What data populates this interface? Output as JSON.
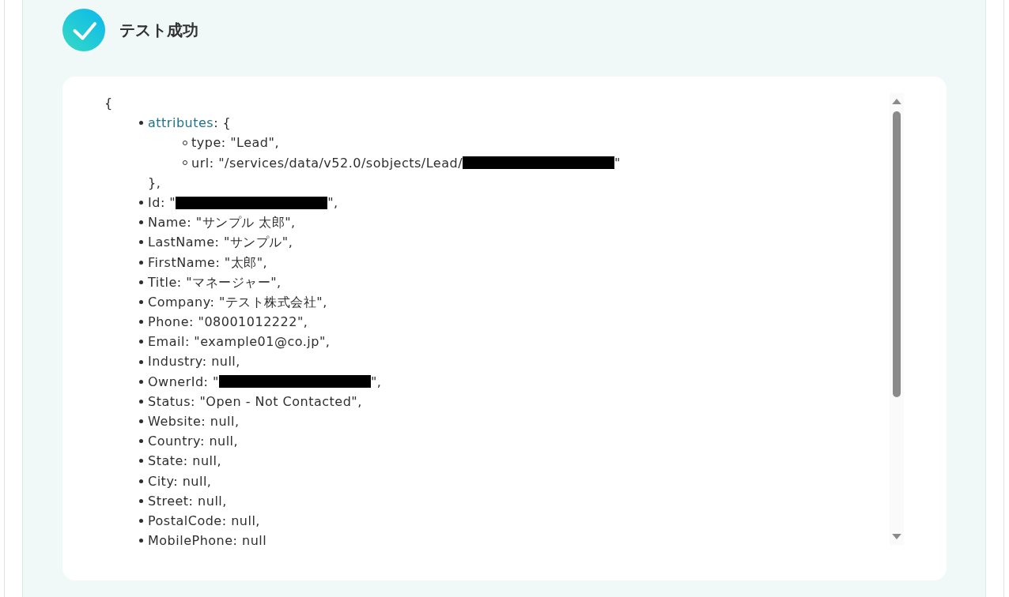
{
  "result": {
    "title": "テスト成功"
  },
  "output": {
    "open": "{",
    "entries": [
      {
        "kind": "object",
        "key": "attributes",
        "open": ": {",
        "children": [
          {
            "kind": "text",
            "text": "type: \"Lead\","
          },
          {
            "kind": "redacted",
            "before": "url: \"/services/data/v52.0/sobjects/Lead/",
            "after": "\""
          }
        ],
        "close": "},"
      },
      {
        "kind": "redacted",
        "before": "Id: \"",
        "after": "\","
      },
      {
        "kind": "text",
        "text": "Name: \"サンプル 太郎\","
      },
      {
        "kind": "text",
        "text": "LastName: \"サンプル\","
      },
      {
        "kind": "text",
        "text": "FirstName: \"太郎\","
      },
      {
        "kind": "text",
        "text": "Title: \"マネージャー\","
      },
      {
        "kind": "text",
        "text": "Company: \"テスト株式会社\","
      },
      {
        "kind": "text",
        "text": "Phone: \"08001012222\","
      },
      {
        "kind": "text",
        "text": "Email: \"example01@co.jp\","
      },
      {
        "kind": "text",
        "text": "Industry: null,"
      },
      {
        "kind": "redacted",
        "before": "OwnerId: \"",
        "after": "\","
      },
      {
        "kind": "text",
        "text": "Status: \"Open - Not Contacted\","
      },
      {
        "kind": "text",
        "text": "Website: null,"
      },
      {
        "kind": "text",
        "text": "Country: null,"
      },
      {
        "kind": "text",
        "text": "State: null,"
      },
      {
        "kind": "text",
        "text": "City: null,"
      },
      {
        "kind": "text",
        "text": "Street: null,"
      },
      {
        "kind": "text",
        "text": "PostalCode: null,"
      },
      {
        "kind": "text",
        "text": "MobilePhone: null"
      }
    ]
  }
}
